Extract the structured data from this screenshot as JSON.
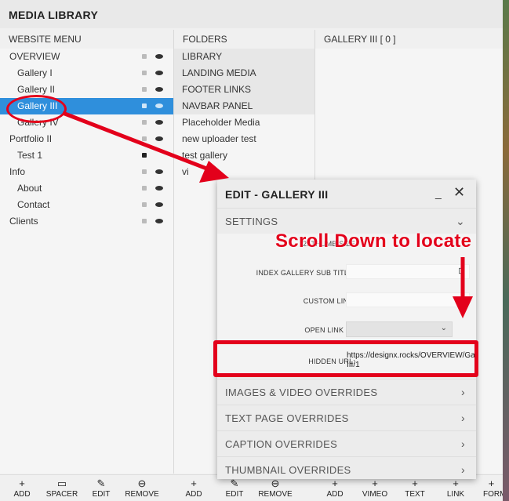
{
  "app": {
    "title": "MEDIA LIBRARY"
  },
  "columns": {
    "website_menu": "WEBSITE MENU",
    "folders": "FOLDERS",
    "gallery": "GALLERY III  [ 0 ]"
  },
  "menu": {
    "items": [
      {
        "label": "OVERVIEW"
      },
      {
        "label": "Gallery I"
      },
      {
        "label": "Gallery II"
      },
      {
        "label": "Gallery III"
      },
      {
        "label": "Gallery IV"
      },
      {
        "label": "Portfolio II"
      },
      {
        "label": "Test 1"
      },
      {
        "label": "Info"
      },
      {
        "label": "About"
      },
      {
        "label": "Contact"
      },
      {
        "label": "Clients"
      }
    ]
  },
  "folders": {
    "items": [
      {
        "label": "LIBRARY"
      },
      {
        "label": "LANDING MEDIA"
      },
      {
        "label": "FOOTER LINKS"
      },
      {
        "label": "NAVBAR PANEL"
      },
      {
        "label": "Placeholder Media"
      },
      {
        "label": "new uploader test"
      },
      {
        "label": "test gallery"
      },
      {
        "label": "vi"
      }
    ]
  },
  "edit_panel": {
    "title": "EDIT - GALLERY III",
    "settings_label": "SETTINGS",
    "fields": {
      "thumb_label": "2. THUMB SIZE",
      "sub_title_label": "INDEX GALLERY SUB TITLE:",
      "custom_link_label": "CUSTOM LINK:",
      "open_link_label": "OPEN LINK IN:",
      "hidden_url_label": "HIDDEN URL:",
      "hidden_url_value": "https://designx.rocks/OVERVIEW/Gallery-III/1"
    },
    "sections": [
      {
        "label": "IMAGES & VIDEO OVERRIDES"
      },
      {
        "label": "TEXT PAGE OVERRIDES"
      },
      {
        "label": "CAPTION OVERRIDES"
      },
      {
        "label": "THUMBNAIL OVERRIDES"
      }
    ]
  },
  "toolbar": {
    "menu": [
      {
        "icon": "+",
        "label": "ADD"
      },
      {
        "icon": "▭",
        "label": "SPACER"
      },
      {
        "icon": "✎",
        "label": "EDIT"
      },
      {
        "icon": "⊖",
        "label": "REMOVE"
      }
    ],
    "folders": [
      {
        "icon": "+",
        "label": "ADD"
      },
      {
        "icon": "✎",
        "label": "EDIT"
      },
      {
        "icon": "⊖",
        "label": "REMOVE"
      }
    ],
    "gallery": [
      {
        "icon": "+",
        "label": "ADD"
      },
      {
        "icon": "+",
        "label": "VIMEO"
      },
      {
        "icon": "+",
        "label": "TEXT"
      },
      {
        "icon": "+",
        "label": "LINK"
      },
      {
        "icon": "+",
        "label": "FORM"
      }
    ]
  },
  "annotation": {
    "text": "Scroll Down to locate"
  },
  "colors": {
    "selected": "#2f8fdc",
    "annotation": "#e3001b"
  }
}
